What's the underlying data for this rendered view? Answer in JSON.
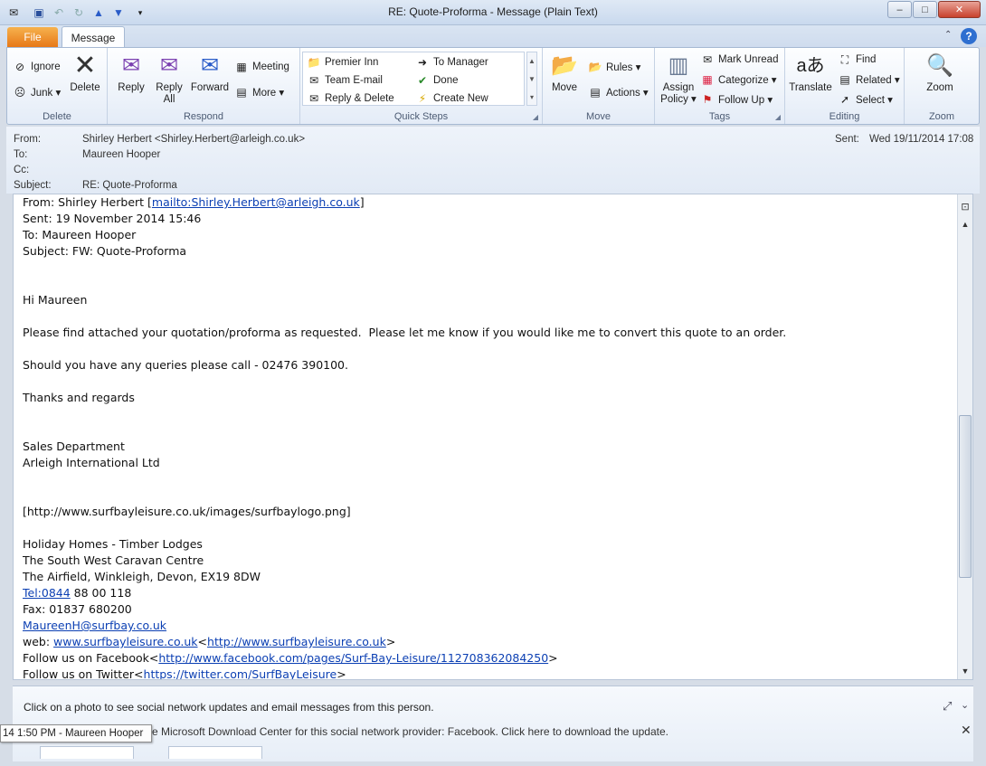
{
  "window": {
    "title": "RE: Quote-Proforma  -  Message (Plain Text)",
    "minimize": "–",
    "maximize": "□",
    "close": "✕"
  },
  "tabs": {
    "file": "File",
    "message": "Message"
  },
  "ribbon": {
    "delete_group": {
      "label": "Delete",
      "ignore": "Ignore",
      "junk": "Junk ▾",
      "delete": "Delete"
    },
    "respond_group": {
      "label": "Respond",
      "reply": "Reply",
      "reply_all_1": "Reply",
      "reply_all_2": "All",
      "forward": "Forward",
      "meeting": "Meeting",
      "more": "More ▾"
    },
    "quicksteps_group": {
      "label": "Quick Steps",
      "items": [
        "Premier Inn",
        "To Manager",
        "Team E-mail",
        "Done",
        "Reply & Delete",
        "Create New"
      ]
    },
    "move_group": {
      "label": "Move",
      "move": "Move",
      "rules": "Rules ▾",
      "actions": "Actions ▾"
    },
    "tags_group": {
      "label": "Tags",
      "assign_policy_1": "Assign",
      "assign_policy_2": "Policy ▾",
      "mark_unread": "Mark Unread",
      "categorize": "Categorize ▾",
      "follow_up": "Follow Up ▾"
    },
    "editing_group": {
      "label": "Editing",
      "translate": "Translate",
      "find": "Find",
      "related": "Related ▾",
      "select": "Select ▾"
    },
    "zoom_group": {
      "label": "Zoom",
      "zoom": "Zoom"
    }
  },
  "header": {
    "from_label": "From:",
    "from_value": "Shirley Herbert <Shirley.Herbert@arleigh.co.uk>",
    "to_label": "To:",
    "to_value": "Maureen Hooper",
    "cc_label": "Cc:",
    "subject_label": "Subject:",
    "subject_value": "RE: Quote-Proforma",
    "sent_label": "Sent:",
    "sent_value": "Wed 19/11/2014 17:08"
  },
  "body": {
    "l1_pre": "From: Shirley Herbert [",
    "l1_link": "mailto:Shirley.Herbert@arleigh.co.uk",
    "l1_post": "]",
    "l2": "Sent: 19 November 2014 15:46",
    "l3": "To: Maureen Hooper",
    "l4": "Subject: FW: Quote-Proforma",
    "greeting": "Hi Maureen",
    "para1": "Please find attached your quotation/proforma as requested.  Please let me know if you would like me to convert this quote to an order.",
    "para2": "Should you have any queries please call - 02476 390100.",
    "thanks": "Thanks and regards",
    "dept": "Sales Department",
    "company": "Arleigh International Ltd",
    "image_url": "[http://www.surfbayleisure.co.uk/images/surfbaylogo.png]",
    "sig1": "Holiday Homes - Timber Lodges",
    "sig2": "The South West Caravan Centre",
    "sig3": "The Airfield, Winkleigh, Devon, EX19 8DW",
    "tel_link": "Tel:0844",
    "tel_rest": " 88 00 118",
    "fax": "Fax: 01837 680200",
    "email_link": "MaureenH@surfbay.co.uk",
    "web_pre": "web: ",
    "web_link1": "www.surfbayleisure.co.uk",
    "web_mid": "<",
    "web_link2": "http://www.surfbayleisure.co.uk",
    "web_post": ">",
    "fb_pre": "Follow us on Facebook<",
    "fb_link": "http://www.facebook.com/pages/Surf-Bay-Leisure/112708362084250",
    "fb_post": ">",
    "tw_pre": "Follow us on Twitter<",
    "tw_link": "https://twitter.com/SurfBayLeisure",
    "tw_post": ">"
  },
  "people_pane": {
    "info": "Click on a photo to see social network updates and email messages from this person.",
    "update_msg": "e Microsoft Download Center for this social network provider: Facebook. Click here to download the update.",
    "tooltip": "14 1:50 PM - Maureen Hooper"
  }
}
